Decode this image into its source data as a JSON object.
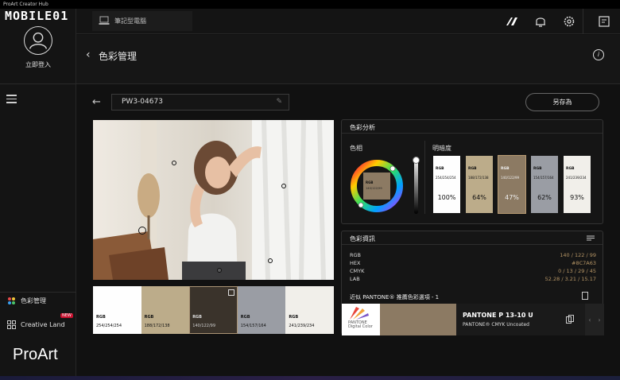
{
  "titlebar": {
    "app_name": "ProArt Creator Hub"
  },
  "sidebar": {
    "login_label": "立即登入",
    "watermark": "MOBILE01",
    "nav": [
      {
        "label": "色彩管理"
      },
      {
        "label": "Creative Land",
        "badge": "NEW"
      }
    ],
    "brand": "ProArt"
  },
  "topbar": {
    "device_tab": "筆記型電腦"
  },
  "header": {
    "title": "色彩管理"
  },
  "toolbar": {
    "profile_name": "PW3-04673",
    "save_as_label": "另存為"
  },
  "palette": [
    {
      "label": "RGB",
      "value": "254/254/254",
      "color": "#fefefe"
    },
    {
      "label": "RGB",
      "value": "188/172/138",
      "color": "#bcac8a"
    },
    {
      "label": "RGB",
      "value": "140/122/99",
      "color": "#3a332b",
      "selected": true
    },
    {
      "label": "RGB",
      "value": "154/157/164",
      "color": "#9a9da4"
    },
    {
      "label": "RGB",
      "value": "241/239/234",
      "color": "#f1efea"
    }
  ],
  "analysis": {
    "title": "色彩分析",
    "hue_label": "色相",
    "brightness_label": "明暗度",
    "wheel_label": "RGB",
    "wheel_value": "140/122/99",
    "cards": [
      {
        "label": "RGB",
        "value": "254/254/254",
        "pct": "100%",
        "color": "#fefefe"
      },
      {
        "label": "RGB",
        "value": "188/172/138",
        "pct": "64%",
        "color": "#bcac8a"
      },
      {
        "label": "RGB",
        "value": "140/122/99",
        "pct": "47%",
        "color": "#8c7a63",
        "selected": true
      },
      {
        "label": "RGB",
        "value": "154/157/164",
        "pct": "62%",
        "color": "#9a9da4"
      },
      {
        "label": "RGB",
        "value": "241/239/234",
        "pct": "93%",
        "color": "#f1efea"
      }
    ]
  },
  "info": {
    "title": "色彩資訊",
    "rows": [
      {
        "key": "RGB",
        "val": "140 / 122 / 99"
      },
      {
        "key": "HEX",
        "val": "#8C7A63"
      },
      {
        "key": "CMYK",
        "val": "0 / 13 / 29 / 45"
      },
      {
        "key": "LAB",
        "val": "52.28 / 3.21 / 15.17"
      }
    ],
    "pantone_heading": "近似 PANTONE® 推薦色彩選項 - 1",
    "pantone_logo": "PANTONE",
    "pantone_logo_sub": "Digital Color",
    "pantone_name": "PANTONE P 13-10 U",
    "pantone_sub": "PANTONE® CMYK Uncoated",
    "pantone_color": "#8c7a63"
  },
  "colors": {
    "accent": "#b59565",
    "background": "#111111"
  }
}
